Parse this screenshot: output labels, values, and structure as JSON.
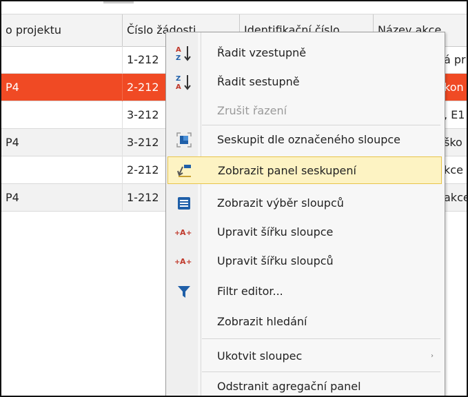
{
  "grid": {
    "columns": [
      {
        "label": "o projektu"
      },
      {
        "label": "Číslo žádosti"
      },
      {
        "label": "Identifikační číslo"
      },
      {
        "label": "Název akce"
      }
    ],
    "rows": [
      {
        "col1": "",
        "col2": "1-212",
        "col4": "á pr"
      },
      {
        "col1": "P4",
        "col2": "2-212",
        "col4": "kon"
      },
      {
        "col1": "",
        "col2": "3-212",
        "col4": ", E1"
      },
      {
        "col1": "P4",
        "col2": "3-212",
        "col4": "ško"
      },
      {
        "col1": "",
        "col2": "2-212",
        "col4": "kce"
      },
      {
        "col1": "P4",
        "col2": "1-212",
        "col4": "akce"
      }
    ]
  },
  "menu": {
    "items": [
      {
        "label": "Řadit vzestupně",
        "icon": "sort-ascending-icon"
      },
      {
        "label": "Řadit sestupně",
        "icon": "sort-descending-icon"
      },
      {
        "label": "Zrušit řazení",
        "icon": "",
        "disabled": true
      },
      {
        "label": "Seskupit dle označeného sloupce",
        "icon": "group-by-column-icon"
      },
      {
        "label": "Zobrazit panel seskupení",
        "icon": "group-panel-icon",
        "highlighted": true
      },
      {
        "label": "Zobrazit výběr sloupců",
        "icon": "column-chooser-icon"
      },
      {
        "label": "Upravit šířku sloupce",
        "icon": "best-fit-column-icon"
      },
      {
        "label": "Upravit šířku sloupců",
        "icon": "best-fit-columns-icon"
      },
      {
        "label": "Filtr editor...",
        "icon": "filter-icon"
      },
      {
        "label": "Zobrazit hledání",
        "icon": ""
      },
      {
        "label": "Ukotvit sloupec",
        "icon": "",
        "submenu": true
      },
      {
        "label": "Odstranit agregační panel",
        "icon": ""
      }
    ],
    "submenu_arrow": "›"
  },
  "colors": {
    "selected_row": "#f04a24",
    "highlight_bg": "#fdf3c3",
    "highlight_border": "#e8c44a",
    "icon_blue": "#1f5fa8",
    "icon_red": "#c0392b"
  }
}
